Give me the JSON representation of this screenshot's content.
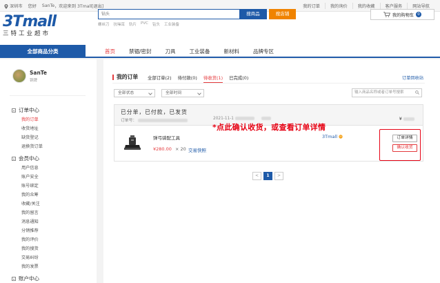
{
  "topbar": {
    "location": "深圳市",
    "greeting": "您好",
    "username": "SanTe",
    "welcome": "，欢迎来到 3Tmall",
    "logout": "[退出]",
    "links": [
      "我的订单",
      "我的询价",
      "我的收藏",
      "客户服务",
      "网站导航"
    ]
  },
  "header": {
    "logo_main": "3Tmall",
    "logo_sub": "三特工业超市",
    "search_placeholder": "钻头",
    "search_button": "搜商品",
    "shop_button": "搜店铺",
    "hot_keywords": [
      "螺丝刀",
      "抗噪耳",
      "轨片",
      "PVC",
      "钻头",
      "工业装备"
    ],
    "cart_label": "我的购物车",
    "cart_count": "0"
  },
  "nav": {
    "all_categories": "全部商品分类",
    "items": [
      "首页",
      "禁锢/密封",
      "刀具",
      "工业装备",
      "新材料",
      "品牌专区"
    ]
  },
  "sidebar": {
    "user_name": "SanTe",
    "user_level": "铜牌",
    "sections": [
      {
        "title": "订单中心",
        "items": [
          "我的订单",
          "收货地址",
          "缺货登记",
          "退换货订单"
        ]
      },
      {
        "title": "会员中心",
        "items": [
          "用户信息",
          "账户安全",
          "账号绑定",
          "我的众筹",
          "收藏/关注",
          "我的留言",
          "消息通知",
          "分销推荐",
          "我的评价",
          "我的搜货",
          "交易纠纷",
          "我的发票"
        ]
      },
      {
        "title": "账户中心",
        "items": []
      }
    ]
  },
  "main": {
    "title": "我的订单",
    "tabs": [
      "全部订单(2)",
      "待付款(0)",
      "待收货(1)",
      "已完成(0)"
    ],
    "active_tab": 2,
    "recycle_link": "订单回收站",
    "filter_status": "全部状态",
    "filter_time": "全部时间",
    "order_search_placeholder": "输入商品名称或者订单号搜索",
    "order": {
      "status": "已分单，已付款，已发货",
      "order_no_label": "订单号：",
      "time_prefix": "2021-11-1",
      "price_prefix": "¥",
      "product_name": "弹弓骑配工具",
      "product_price": "¥280.00",
      "product_qty": "× 20",
      "snapshot_link": "交易快照",
      "shop_name": "3Tmall",
      "detail_button": "订单详情",
      "confirm_button": "确认收货"
    },
    "callout": "*点此确认收货，或查看订单详情",
    "pager": {
      "prev": "<",
      "current": "1",
      "next": ">"
    }
  },
  "colors": {
    "brand_blue": "#1e5aa8",
    "accent_red": "#e4393c",
    "shop_orange": "#f08300"
  }
}
